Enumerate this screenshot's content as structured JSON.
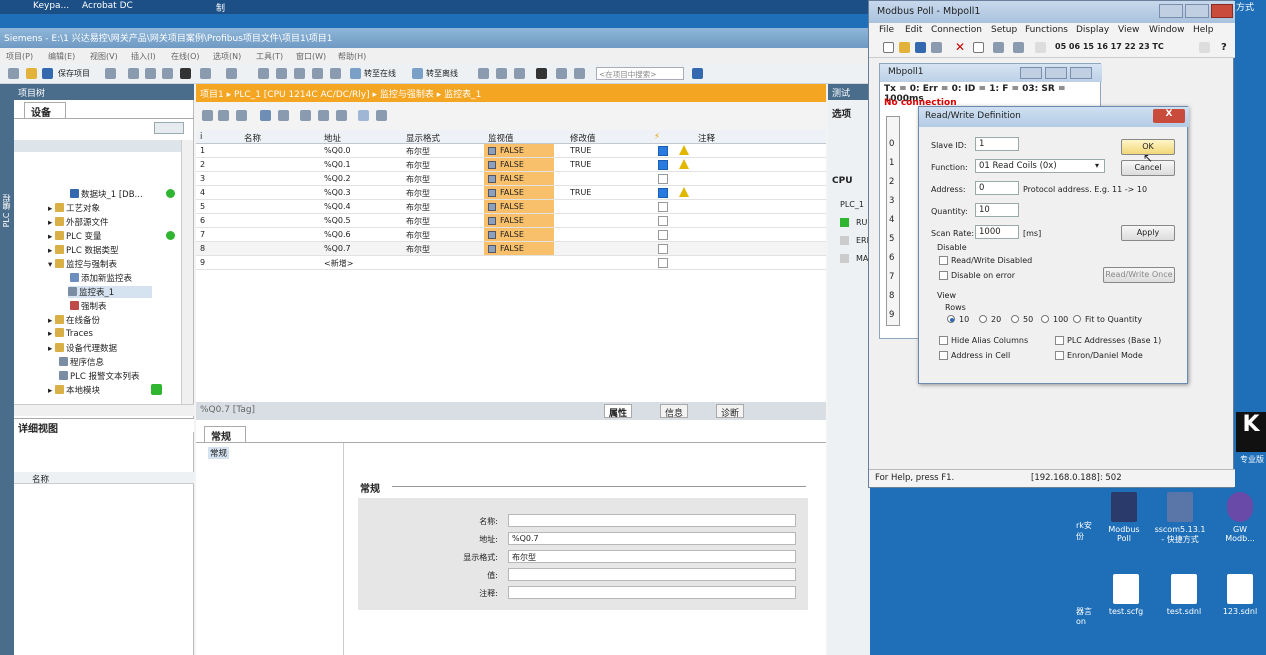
{
  "taskbar": {
    "item1": "Keypa...",
    "item2": "Acrobat DC",
    "item3": "制",
    "right": "方式"
  },
  "tia": {
    "title": "Siemens  -  E:\\1 兴达易控\\网关产品\\网关项目案例\\Profibus项目文件\\项目1\\项目1",
    "menu": [
      "项目(P)",
      "编辑(E)",
      "视图(V)",
      "插入(I)",
      "在线(O)",
      "选项(N)",
      "工具(T)",
      "窗口(W)",
      "帮助(H)"
    ],
    "toolbar": {
      "save": "保存项目",
      "online": "转至在线",
      "offline": "转至离线",
      "search_placeholder": "<在项目中搜索>"
    },
    "side_label": "PLC 编程",
    "project_tree": {
      "header": "项目树",
      "tab": "设备",
      "items": [
        "数据块_1 [DB...",
        "工艺对象",
        "外部源文件",
        "PLC 变量",
        "PLC 数据类型",
        "监控与强制表",
        "添加新监控表",
        "监控表_1",
        "强制表",
        "在线备份",
        "Traces",
        "设备代理数据",
        "程序信息",
        "PLC 报警文本列表",
        "本地模块"
      ],
      "detail_title": "详细视图",
      "detail_col": "名称"
    },
    "editor": {
      "breadcrumb": "项目1  ▸  PLC_1 [CPU 1214C AC/DC/Rly]  ▸  监控与强制表  ▸  监控表_1",
      "columns": [
        "i",
        "名称",
        "地址",
        "显示格式",
        "监视值",
        "修改值",
        "",
        "注释"
      ],
      "rows": [
        {
          "n": "1",
          "addr": "%Q0.0",
          "fmt": "布尔型",
          "val": "FALSE",
          "mod": "TRUE",
          "chk": true,
          "warn": true
        },
        {
          "n": "2",
          "addr": "%Q0.1",
          "fmt": "布尔型",
          "val": "FALSE",
          "mod": "TRUE",
          "chk": true,
          "warn": true
        },
        {
          "n": "3",
          "addr": "%Q0.2",
          "fmt": "布尔型",
          "val": "FALSE",
          "mod": "",
          "chk": false,
          "warn": false
        },
        {
          "n": "4",
          "addr": "%Q0.3",
          "fmt": "布尔型",
          "val": "FALSE",
          "mod": "TRUE",
          "chk": true,
          "warn": true
        },
        {
          "n": "5",
          "addr": "%Q0.4",
          "fmt": "布尔型",
          "val": "FALSE",
          "mod": "",
          "chk": false,
          "warn": false
        },
        {
          "n": "6",
          "addr": "%Q0.5",
          "fmt": "布尔型",
          "val": "FALSE",
          "mod": "",
          "chk": false,
          "warn": false
        },
        {
          "n": "7",
          "addr": "%Q0.6",
          "fmt": "布尔型",
          "val": "FALSE",
          "mod": "",
          "chk": false,
          "warn": false
        },
        {
          "n": "8",
          "addr": "%Q0.7",
          "fmt": "布尔型",
          "val": "FALSE",
          "mod": "",
          "chk": false,
          "warn": false
        },
        {
          "n": "9",
          "addr": "<新增>",
          "fmt": "",
          "val": "",
          "mod": "",
          "chk": false,
          "warn": false
        }
      ]
    },
    "props": {
      "head": "%Q0.7 [Tag]",
      "tabs": [
        "属性",
        "信息",
        "诊断"
      ],
      "subtab": "常规",
      "left_item": "常规",
      "section": "常规",
      "labels": [
        "名称:",
        "地址:",
        "显示格式:",
        "值:",
        "注释:"
      ],
      "values": [
        "",
        "%Q0.7",
        "布尔型",
        "",
        ""
      ]
    },
    "test": {
      "title": "测试",
      "sub": "选项",
      "cpu": "CPU",
      "plc": "PLC_1",
      "run": "RU",
      "err": "ERI",
      "ma": "MA"
    }
  },
  "modbus": {
    "title": "Modbus Poll - Mbpoll1",
    "menu": [
      "File",
      "Edit",
      "Connection",
      "Setup",
      "Functions",
      "Display",
      "View",
      "Window",
      "Help"
    ],
    "codes": "05 06 15 16 17 22 23  TC",
    "child_title": "Mbpoll1",
    "txline": "Tx = 0: Err = 0: ID = 1: F = 03: SR = 1000ms",
    "noconn": "No connection",
    "rownums": [
      "0",
      "1",
      "2",
      "3",
      "4",
      "5",
      "6",
      "7",
      "8",
      "9"
    ],
    "status_left": "For Help, press F1.",
    "status_right": "[192.168.0.188]: 502"
  },
  "dialog": {
    "title": "Read/Write Definition",
    "close": "X",
    "slave_label": "Slave ID:",
    "slave_val": "1",
    "func_label": "Function:",
    "func_val": "01 Read Coils (0x)",
    "addr_label": "Address:",
    "addr_val": "0",
    "proto": "Protocol address. E.g. 11 -> 10",
    "qty_label": "Quantity:",
    "qty_val": "10",
    "scan_label": "Scan Rate:",
    "scan_val": "1000",
    "ms": "[ms]",
    "ok": "OK",
    "cancel": "Cancel",
    "apply": "Apply",
    "rwonce": "Read/Write Once",
    "disable": "Disable",
    "rw_disabled": "Read/Write Disabled",
    "dis_err": "Disable on error",
    "view": "View",
    "rows": "Rows",
    "r10": "10",
    "r20": "20",
    "r50": "50",
    "r100": "100",
    "fit": "Fit to Quantity",
    "hide_alias": "Hide Alias Columns",
    "plc_addr": "PLC Addresses (Base 1)",
    "addr_cell": "Address in Cell",
    "enron": "Enron/Daniel Mode"
  },
  "desktop": [
    {
      "label": "Modbus\nPoll"
    },
    {
      "label": "sscom5.13.1\n- 快捷方式"
    },
    {
      "label": "GW\nModb..."
    },
    {
      "label": "test.scfg"
    },
    {
      "label": "test.sdnl"
    },
    {
      "label": "123.sdnl"
    }
  ],
  "desktop_left": [
    "rk安\n份",
    "器言\non"
  ],
  "desktop_right": "专业版"
}
